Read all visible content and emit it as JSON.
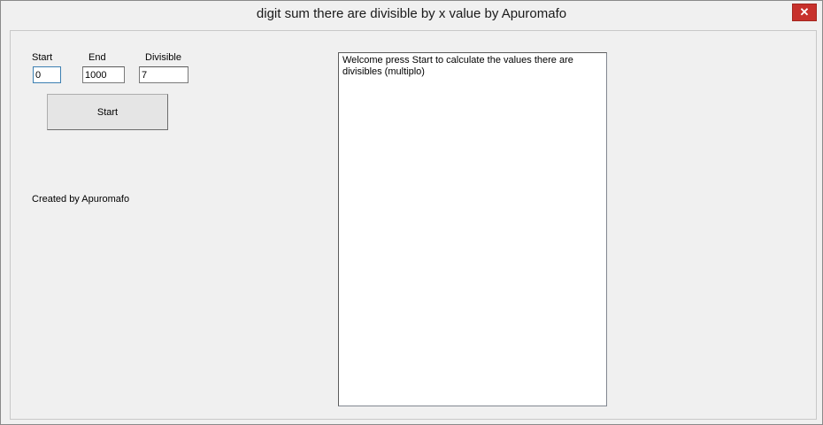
{
  "window": {
    "title": "digit sum there are divisible by x value by Apuromafo",
    "close_glyph": "✕"
  },
  "form": {
    "start_label": "Start",
    "end_label": "End",
    "divisible_label": "Divisible",
    "start_value": "0",
    "end_value": "1000",
    "divisible_value": "7",
    "start_button_label": "Start",
    "credit_text": "Created by Apuromafo"
  },
  "output": {
    "text": "Welcome press Start to calculate the values there are divisibles (multiplo)"
  },
  "icons": {
    "close": "close-icon"
  },
  "colors": {
    "close_button": "#c7312c",
    "window_bg": "#f0f0f0"
  }
}
